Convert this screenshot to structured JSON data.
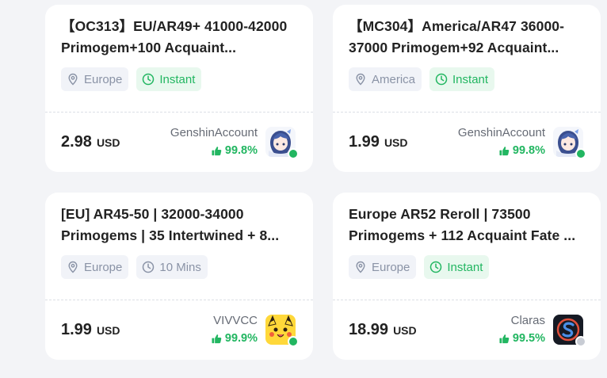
{
  "listings": [
    {
      "title": "【OC313】EU/AR49+ 41000-42000 Primogem+100 Acquaint...",
      "region": "Europe",
      "delivery": "Instant",
      "price": "2.98",
      "currency": "USD",
      "seller": "GenshinAccount",
      "rating": "99.8%",
      "online": "true"
    },
    {
      "title": "【MC304】America/AR47 36000-37000 Primogem+92 Acquaint...",
      "region": "America",
      "delivery": "Instant",
      "price": "1.99",
      "currency": "USD",
      "seller": "GenshinAccount",
      "rating": "99.8%",
      "online": "true"
    },
    {
      "title": "[EU] AR45-50 | 32000-34000 Primogems | 35 Intertwined + 8...",
      "region": "Europe",
      "delivery": "10 Mins",
      "price": "1.99",
      "currency": "USD",
      "seller": "VIVVCC",
      "rating": "99.9%",
      "online": "true"
    },
    {
      "title": "Europe AR52 Reroll | 73500 Primogems + 112 Acquaint Fate ...",
      "region": "Europe",
      "delivery": "Instant",
      "price": "18.99",
      "currency": "USD",
      "seller": "Claras",
      "rating": "99.5%",
      "online": "false"
    }
  ],
  "colors": {
    "green": "#22b661",
    "gray_tag": "#8a93a6",
    "offline": "#c8ccd4"
  }
}
